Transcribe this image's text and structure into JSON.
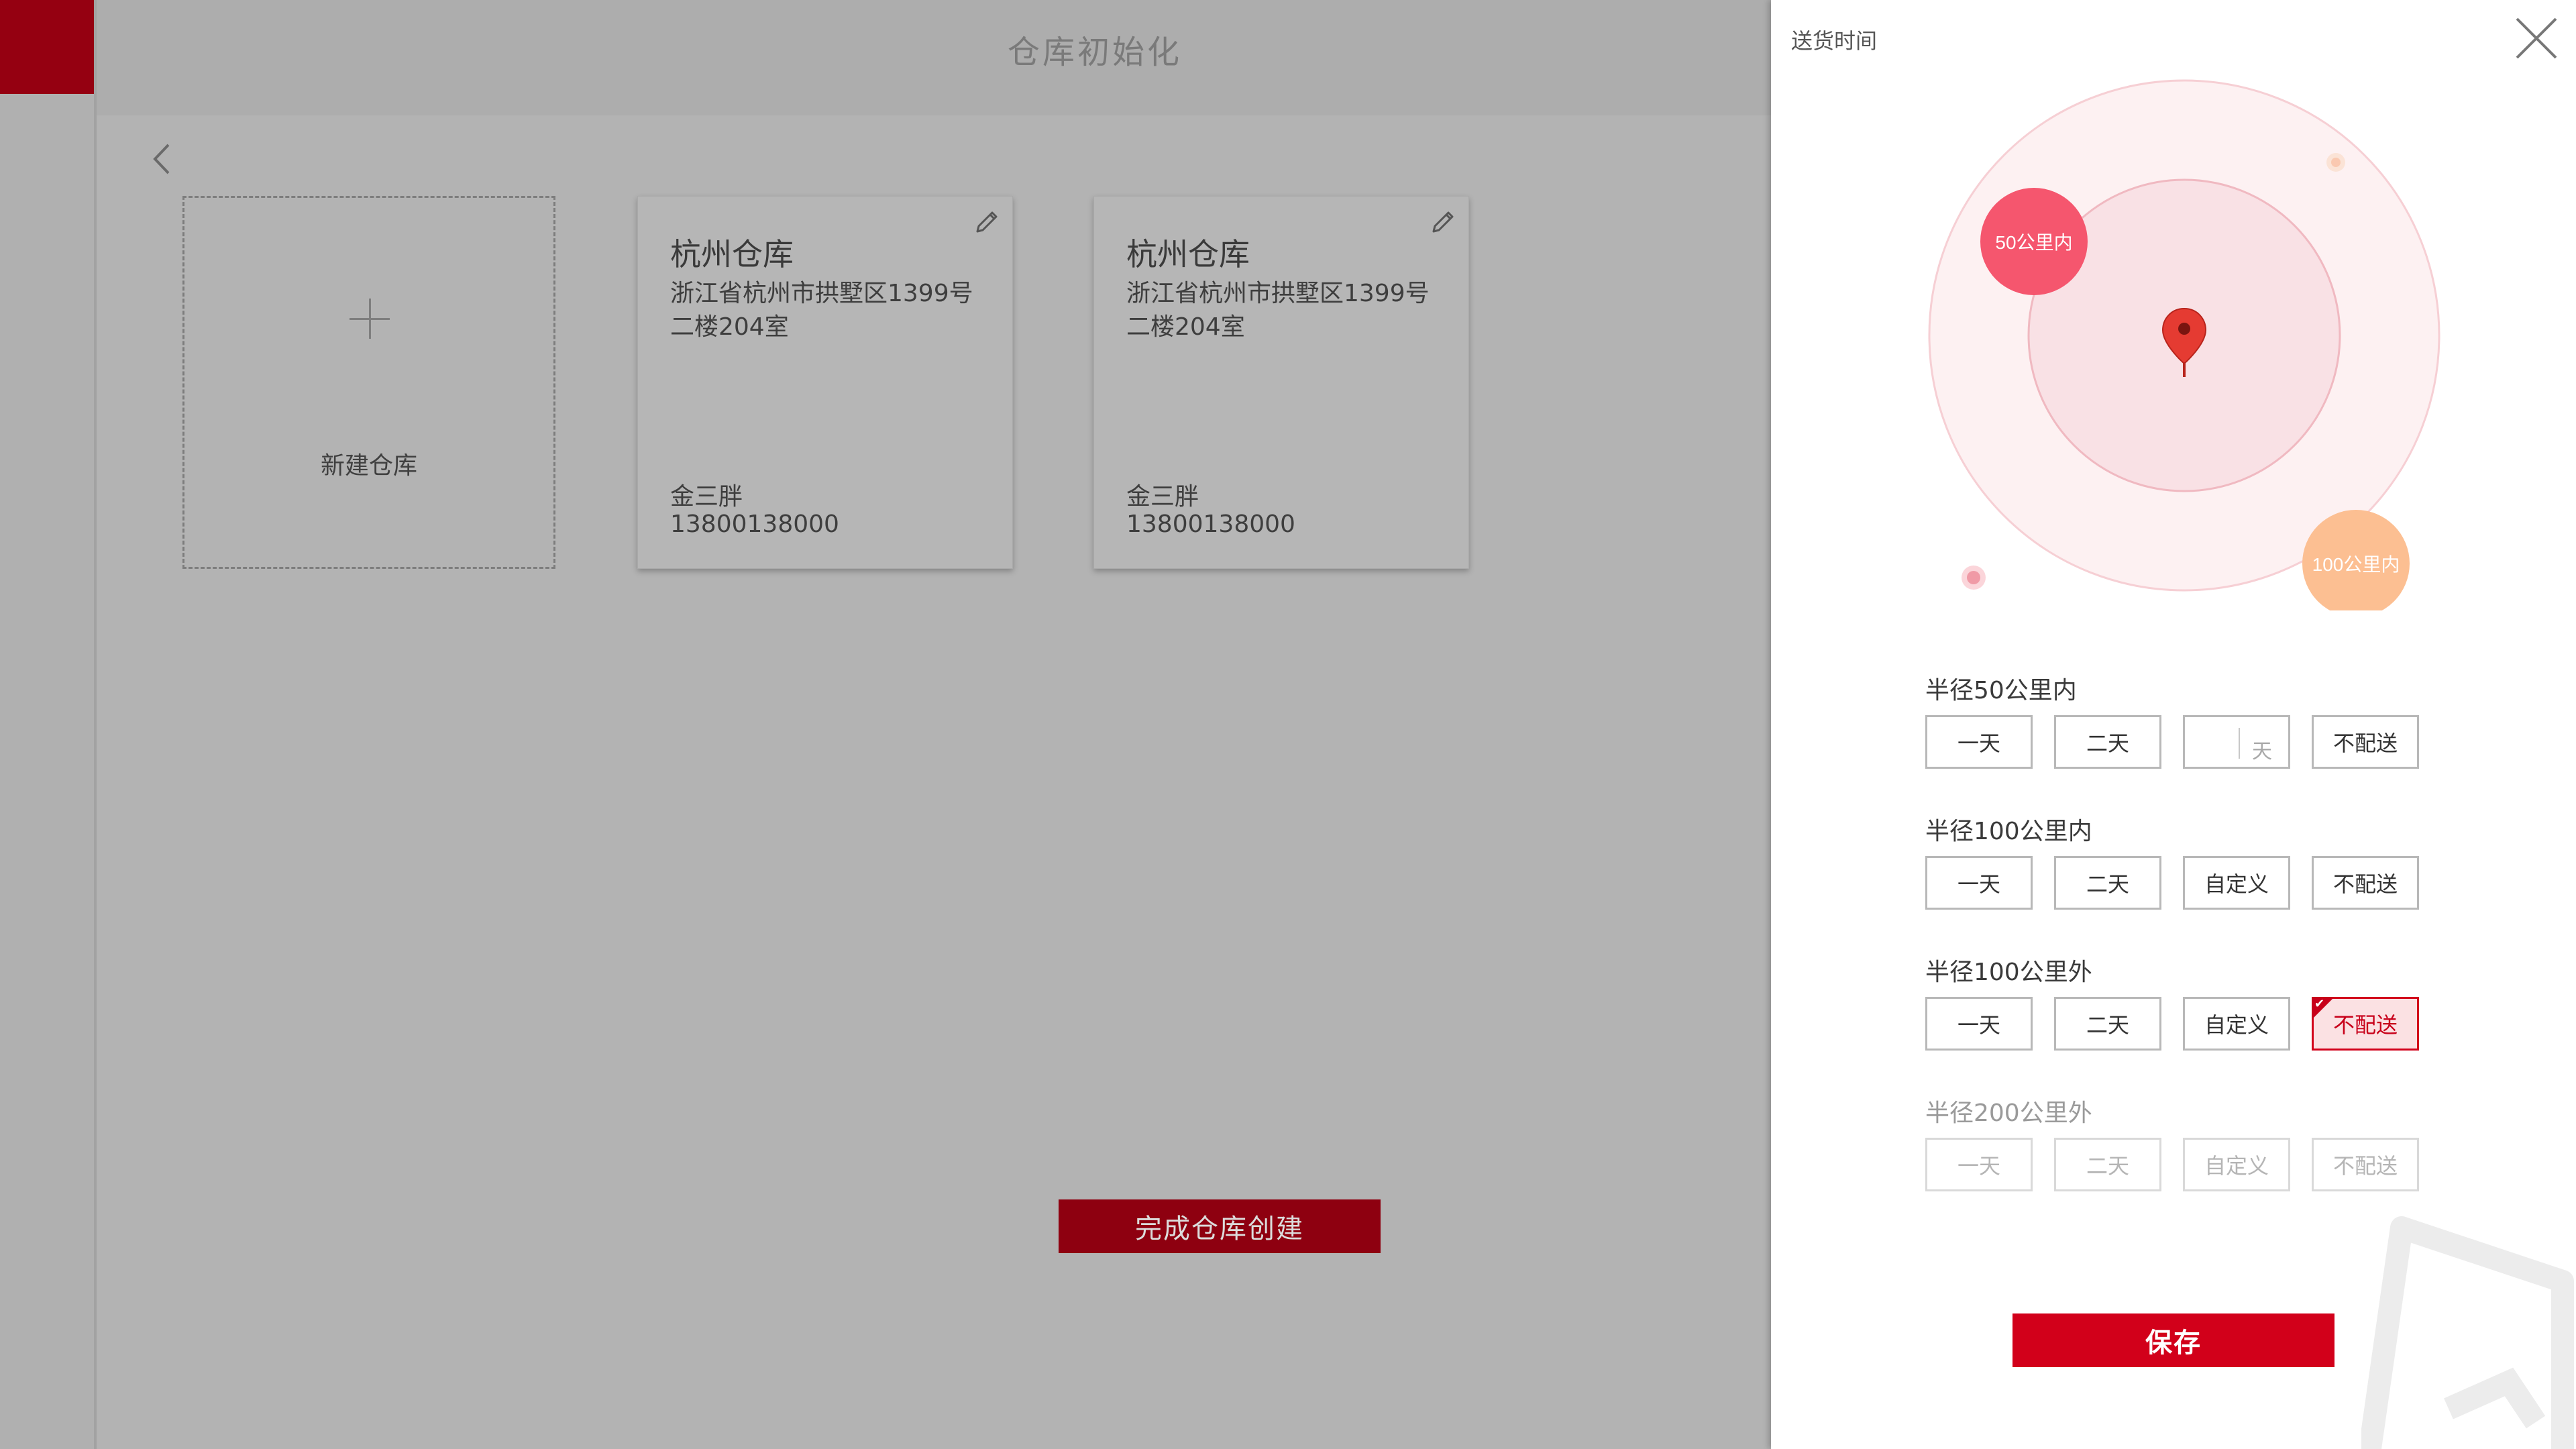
{
  "page": {
    "title": "仓库初始化",
    "new_warehouse_label": "新建仓库",
    "finish_label": "完成仓库创建",
    "brand_color": "#950011"
  },
  "warehouses": [
    {
      "name": "杭州仓库",
      "address": "浙江省杭州市拱墅区1399号二楼204室",
      "contact": "金三胖",
      "phone": "13800138000"
    },
    {
      "name": "杭州仓库",
      "address": "浙江省杭州市拱墅区1399号二楼204室",
      "contact": "金三胖",
      "phone": "13800138000"
    }
  ],
  "drawer": {
    "title": "送货时间",
    "radar": {
      "inner_label": "50公里内",
      "outer_label": "100公里内"
    },
    "ranges": [
      {
        "label": "半径50公里内",
        "options": [
          "一天",
          "二天",
          "",
          "不配送"
        ],
        "custom_unit": "天"
      },
      {
        "label": "半径100公里内",
        "options": [
          "一天",
          "二天",
          "自定义",
          "不配送"
        ]
      },
      {
        "label": "半径100公里外",
        "options": [
          "一天",
          "二天",
          "自定义",
          "不配送"
        ],
        "selected": "不配送"
      },
      {
        "label": "半径200公里外",
        "options": [
          "一天",
          "二天",
          "自定义",
          "不配送"
        ],
        "disabled": true
      }
    ],
    "save_label": "保存",
    "accent_color": "#d2001a"
  }
}
